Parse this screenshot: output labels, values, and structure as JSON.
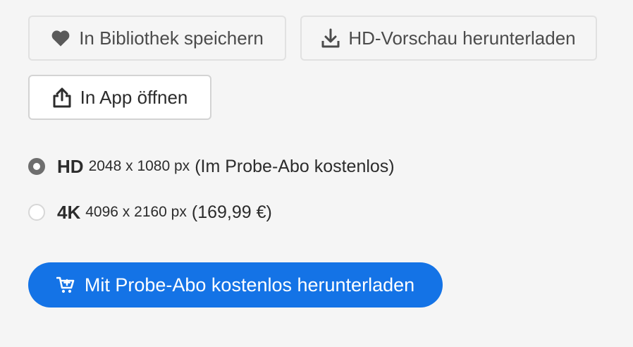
{
  "actions": {
    "save_library": {
      "label": "In Bibliothek speichern",
      "icon": "heart-icon"
    },
    "download_preview": {
      "label": "HD-Vorschau herunterladen",
      "icon": "download-icon"
    },
    "open_in_app": {
      "label": "In App öffnen",
      "icon": "share-icon"
    }
  },
  "options": [
    {
      "name": "HD",
      "size": "2048 x 1080 px",
      "note": "(Im Probe-Abo kostenlos)",
      "selected": true
    },
    {
      "name": "4K",
      "size": "4096 x 2160 px",
      "note": "(169,99 €)",
      "selected": false
    }
  ],
  "cta": {
    "label": "Mit Probe-Abo kostenlos herunterladen",
    "icon": "cart-icon"
  },
  "colors": {
    "cta_background": "#1473e6",
    "page_background": "#f5f5f5",
    "radio_selected": "#6e6e6e"
  }
}
